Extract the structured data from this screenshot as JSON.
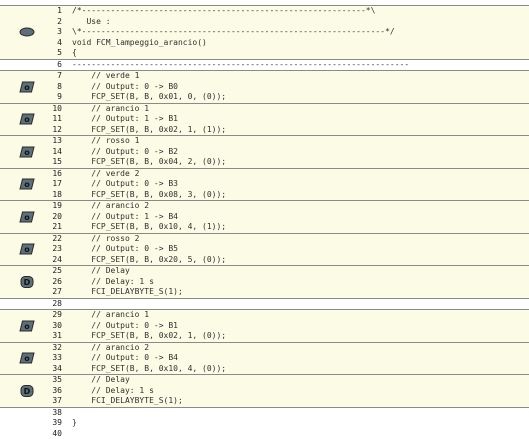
{
  "blocks": [
    {
      "icon": "ellipse-icon",
      "lines": [
        {
          "n": "1",
          "t": "/*-----------------------------------------------------------*\\"
        },
        {
          "n": "2",
          "t": "   Use :"
        },
        {
          "n": "3",
          "t": "\\*---------------------------------------------------------------*/"
        },
        {
          "n": "4",
          "t": "void FCM_lampeggio_arancio()"
        },
        {
          "n": "5",
          "t": "{"
        }
      ]
    },
    {
      "icon": null,
      "lines": [
        {
          "n": "6",
          "t": "----------------------------------------------------------------------"
        }
      ]
    },
    {
      "icon": "output-icon",
      "icon_letter": "o",
      "lines": [
        {
          "n": "7",
          "t": "    // verde 1"
        },
        {
          "n": "8",
          "t": "    // Output: 0 -> B0"
        },
        {
          "n": "9",
          "t": "    FCP_SET(B, B, 0x01, 0, (0));"
        }
      ]
    },
    {
      "icon": "output-icon",
      "icon_letter": "o",
      "lines": [
        {
          "n": "10",
          "t": "    // arancio 1"
        },
        {
          "n": "11",
          "t": "    // Output: 1 -> B1"
        },
        {
          "n": "12",
          "t": "    FCP_SET(B, B, 0x02, 1, (1));"
        }
      ]
    },
    {
      "icon": "output-icon",
      "icon_letter": "o",
      "lines": [
        {
          "n": "13",
          "t": "    // rosso 1"
        },
        {
          "n": "14",
          "t": "    // Output: 0 -> B2"
        },
        {
          "n": "15",
          "t": "    FCP_SET(B, B, 0x04, 2, (0));"
        }
      ]
    },
    {
      "icon": "output-icon",
      "icon_letter": "o",
      "lines": [
        {
          "n": "16",
          "t": "    // verde 2"
        },
        {
          "n": "17",
          "t": "    // Output: 0 -> B3"
        },
        {
          "n": "18",
          "t": "    FCP_SET(B, B, 0x08, 3, (0));"
        }
      ]
    },
    {
      "icon": "output-icon",
      "icon_letter": "o",
      "lines": [
        {
          "n": "19",
          "t": "    // arancio 2"
        },
        {
          "n": "20",
          "t": "    // Output: 1 -> B4"
        },
        {
          "n": "21",
          "t": "    FCP_SET(B, B, 0x10, 4, (1));"
        }
      ]
    },
    {
      "icon": "output-icon",
      "icon_letter": "o",
      "lines": [
        {
          "n": "22",
          "t": "    // rosso 2"
        },
        {
          "n": "23",
          "t": "    // Output: 0 -> B5"
        },
        {
          "n": "24",
          "t": "    FCP_SET(B, B, 0x20, 5, (0));"
        }
      ]
    },
    {
      "icon": "delay-icon",
      "icon_letter": "D",
      "lines": [
        {
          "n": "25",
          "t": "    // Delay"
        },
        {
          "n": "26",
          "t": "    // Delay: 1 s"
        },
        {
          "n": "27",
          "t": "    FCI_DELAYBYTE_S(1);"
        }
      ]
    },
    {
      "icon": null,
      "lines": [
        {
          "n": "28",
          "t": ""
        }
      ]
    },
    {
      "icon": "output-icon",
      "icon_letter": "o",
      "lines": [
        {
          "n": "29",
          "t": "    // arancio 1"
        },
        {
          "n": "30",
          "t": "    // Output: 0 -> B1"
        },
        {
          "n": "31",
          "t": "    FCP_SET(B, B, 0x02, 1, (0));"
        }
      ]
    },
    {
      "icon": "output-icon",
      "icon_letter": "o",
      "lines": [
        {
          "n": "32",
          "t": "    // arancio 2"
        },
        {
          "n": "33",
          "t": "    // Output: 0 -> B4"
        },
        {
          "n": "34",
          "t": "    FCP_SET(B, B, 0x10, 4, (0));"
        }
      ]
    },
    {
      "icon": "delay-icon",
      "icon_letter": "D",
      "lines": [
        {
          "n": "35",
          "t": "    // Delay"
        },
        {
          "n": "36",
          "t": "    // Delay: 1 s"
        },
        {
          "n": "37",
          "t": "    FCI_DELAYBYTE_S(1);"
        }
      ]
    }
  ],
  "tail_lines": [
    {
      "n": "38",
      "t": ""
    },
    {
      "n": "39",
      "t": "}"
    },
    {
      "n": "40",
      "t": ""
    }
  ],
  "colors": {
    "block_bg": "#fbfbe6",
    "border": "#8a8a8a",
    "icon_fill": "#5f6f7a",
    "icon_stroke": "#2a2a2a"
  }
}
